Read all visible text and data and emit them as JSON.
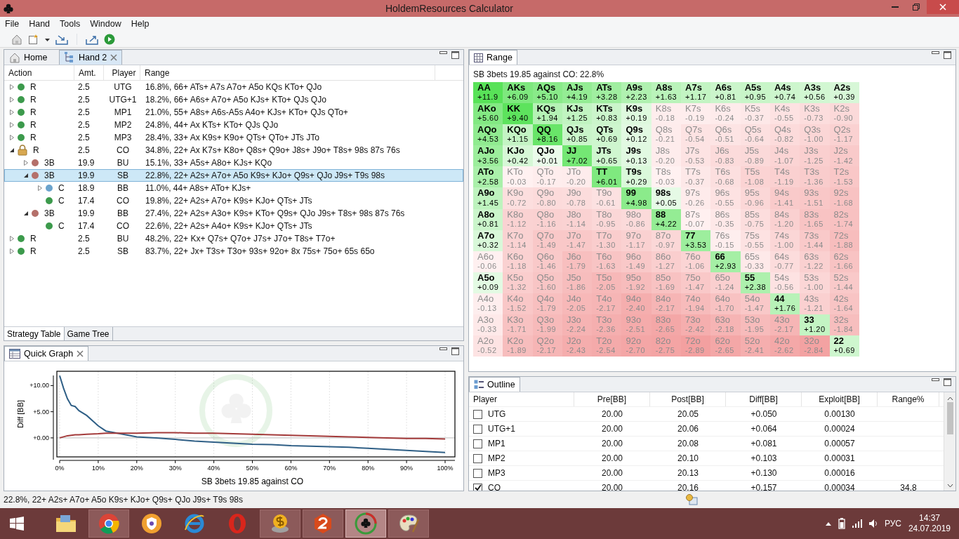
{
  "window": {
    "title": "HoldemResources Calculator"
  },
  "menu": [
    "File",
    "Hand",
    "Tools",
    "Window",
    "Help"
  ],
  "editor": {
    "tabs": [
      {
        "label": "Home",
        "kind": "home",
        "selected": false
      },
      {
        "label": "Hand 2",
        "kind": "hand",
        "selected": true
      }
    ],
    "table": {
      "columns": [
        "Action",
        "Amt.",
        "Player",
        "Range"
      ],
      "rows": [
        {
          "action": "R",
          "amount": "2.5",
          "player": "UTG",
          "range": "16.8%, 66+ ATs+ A7s A7o+ A5o KQs KTo+ QJo",
          "color": "#3c9a4c",
          "locked": false,
          "expanded": false,
          "selected": false
        },
        {
          "action": "R",
          "amount": "2.5",
          "player": "UTG+1",
          "range": "18.2%, 66+ A6s+ A7o+ A5o KJs+ KTo+ QJs QJo",
          "color": "#3c9a4c",
          "locked": false,
          "expanded": false,
          "selected": false
        },
        {
          "action": "R",
          "amount": "2.5",
          "player": "MP1",
          "range": "21.0%, 55+ A8s+ A6s-A5s A4o+ KJs+ KTo+ QJs QTo+",
          "color": "#3c9a4c",
          "locked": false,
          "expanded": false,
          "selected": false
        },
        {
          "action": "R",
          "amount": "2.5",
          "player": "MP2",
          "range": "24.8%, 44+ Ax KTs+ KTo+ QJs QJo",
          "color": "#3c9a4c",
          "locked": false,
          "expanded": false,
          "selected": false
        },
        {
          "action": "R",
          "amount": "2.5",
          "player": "MP3",
          "range": "28.4%, 33+ Ax K9s+ K9o+ QTs+ QTo+ JTs JTo",
          "color": "#3c9a4c",
          "locked": false,
          "expanded": false,
          "selected": false
        },
        {
          "action": "R",
          "amount": "2.5",
          "player": "CO",
          "range": "34.8%, 22+ Ax K7s+ K8o+ Q8s+ Q9o+ J8s+ J9o+ T8s+ 98s 87s 76s",
          "locked": true,
          "expanded": true,
          "selected": false,
          "children": [
            {
              "action": "3B",
              "amount": "19.9",
              "player": "BU",
              "range": "15.1%, 33+ A5s+ A8o+ KJs+ KQo",
              "color": "#b4706a",
              "locked": false,
              "expanded": false,
              "selected": false
            },
            {
              "action": "3B",
              "amount": "19.9",
              "player": "SB",
              "range": "22.8%, 22+ A2s+ A7o+ A5o K9s+ KJo+ Q9s+ QJo J9s+ T9s 98s",
              "color": "#b4706a",
              "locked": false,
              "expanded": true,
              "selected": true,
              "children": [
                {
                  "action": "C",
                  "amount": "18.9",
                  "player": "BB",
                  "range": "11.0%, 44+ A8s+ ATo+ KJs+",
                  "color": "#6ba3cc",
                  "locked": false,
                  "expanded": false,
                  "selected": false
                },
                {
                  "action": "C",
                  "amount": "17.4",
                  "player": "CO",
                  "range": "19.8%, 22+ A2s+ A7o+ K9s+ KJo+ QTs+ JTs",
                  "color": "#3c9a4c",
                  "locked": false,
                  "selected": false
                }
              ]
            },
            {
              "action": "3B",
              "amount": "19.9",
              "player": "BB",
              "range": "27.4%, 22+ A2s+ A3o+ K9s+ KTo+ Q9s+ QJo J9s+ T8s+ 98s 87s 76s",
              "color": "#b4706a",
              "locked": false,
              "expanded": true,
              "selected": false,
              "children": [
                {
                  "action": "C",
                  "amount": "17.4",
                  "player": "CO",
                  "range": "22.6%, 22+ A2s+ A4o+ K9s+ KJo+ QTs+ JTs",
                  "color": "#3c9a4c",
                  "locked": false,
                  "selected": false
                }
              ]
            }
          ]
        },
        {
          "action": "R",
          "amount": "2.5",
          "player": "BU",
          "range": "48.2%, 22+ Kx+ Q7s+ Q7o+ J7s+ J7o+ T8s+ T7o+",
          "color": "#3c9a4c",
          "locked": false,
          "expanded": false,
          "selected": false
        },
        {
          "action": "R",
          "amount": "2.5",
          "player": "SB",
          "range": "83.7%, 22+ Jx+ T3s+ T3o+ 93s+ 92o+ 8x 75s+ 75o+ 65s 65o",
          "color": "#3c9a4c",
          "locked": false,
          "expanded": false,
          "selected": false
        }
      ]
    },
    "bottom_tabs": [
      {
        "label": "Strategy Table",
        "selected": true
      },
      {
        "label": "Game Tree",
        "selected": false
      }
    ]
  },
  "graph": {
    "tab": "Quick Graph",
    "chart_data": {
      "type": "line",
      "xlabel": "SB 3bets 19.85 against CO",
      "ylabel": "Diff [BB]",
      "x": [
        0,
        1,
        2,
        3,
        4,
        5,
        7,
        10,
        12,
        15,
        20,
        25,
        30,
        35,
        40,
        45,
        50,
        55,
        60,
        65,
        70,
        75,
        80,
        85,
        90,
        95,
        100
      ],
      "series": [
        {
          "color": "#2f5f86",
          "values": [
            11.9,
            9.5,
            7.5,
            6.2,
            6.0,
            5.2,
            4.3,
            2.3,
            1.3,
            0.9,
            0.2,
            0.0,
            -0.3,
            -0.6,
            -0.8,
            -1.0,
            -1.2,
            -1.3,
            -1.5,
            -1.6,
            -1.7,
            -1.8,
            -2.0,
            -2.2,
            -2.4,
            -2.6,
            -2.8
          ]
        },
        {
          "color": "#a33a3a",
          "values": [
            0.0,
            0.2,
            0.4,
            0.5,
            0.6,
            0.6,
            0.7,
            0.8,
            0.9,
            0.9,
            0.9,
            1.0,
            1.0,
            0.9,
            0.9,
            0.8,
            0.7,
            0.6,
            0.5,
            0.4,
            0.3,
            0.2,
            0.1,
            0.0,
            -0.1,
            -0.1,
            -0.2
          ]
        }
      ],
      "grid": true,
      "xlim": [
        0,
        100
      ],
      "ylim": [
        -3.5,
        12.6
      ],
      "xticks": [
        {
          "value": 0,
          "label": "0%"
        },
        {
          "value": 10,
          "label": "10%"
        },
        {
          "value": 20,
          "label": "20%"
        },
        {
          "value": 30,
          "label": "30%"
        },
        {
          "value": 40,
          "label": "40%"
        },
        {
          "value": 50,
          "label": "50%"
        },
        {
          "value": 60,
          "label": "60%"
        },
        {
          "value": 70,
          "label": "70%"
        },
        {
          "value": 80,
          "label": "80%"
        },
        {
          "value": 90,
          "label": "90%"
        },
        {
          "value": 100,
          "label": "100%"
        }
      ],
      "yticks": [
        {
          "value": 0,
          "label": "+0.00"
        },
        {
          "value": 5,
          "label": "+5.00"
        },
        {
          "value": 10,
          "label": "+10.00"
        }
      ]
    }
  },
  "range": {
    "tab": "Range",
    "header": "SB 3bets 19.85 against CO: 22.8%",
    "rows": [
      [
        {
          "hand": "AA",
          "ev": "+11.9",
          "in_range": true
        },
        {
          "hand": "AKs",
          "ev": "+6.09",
          "in_range": true
        },
        {
          "hand": "AQs",
          "ev": "+5.10",
          "in_range": true
        },
        {
          "hand": "AJs",
          "ev": "+4.19",
          "in_range": true
        },
        {
          "hand": "ATs",
          "ev": "+3.28",
          "in_range": true
        },
        {
          "hand": "A9s",
          "ev": "+2.23",
          "in_range": true
        },
        {
          "hand": "A8s",
          "ev": "+1.63",
          "in_range": true
        },
        {
          "hand": "A7s",
          "ev": "+1.17",
          "in_range": true
        },
        {
          "hand": "A6s",
          "ev": "+0.81",
          "in_range": true
        },
        {
          "hand": "A5s",
          "ev": "+0.95",
          "in_range": true
        },
        {
          "hand": "A4s",
          "ev": "+0.74",
          "in_range": true
        },
        {
          "hand": "A3s",
          "ev": "+0.56",
          "in_range": true
        },
        {
          "hand": "A2s",
          "ev": "+0.39",
          "in_range": true
        }
      ],
      [
        {
          "hand": "AKo",
          "ev": "+5.60",
          "in_range": true
        },
        {
          "hand": "KK",
          "ev": "+9.40",
          "in_range": true
        },
        {
          "hand": "KQs",
          "ev": "+1.94",
          "in_range": true
        },
        {
          "hand": "KJs",
          "ev": "+1.25",
          "in_range": true
        },
        {
          "hand": "KTs",
          "ev": "+0.83",
          "in_range": true
        },
        {
          "hand": "K9s",
          "ev": "+0.19",
          "in_range": true
        },
        {
          "hand": "K8s",
          "ev": "-0.18",
          "in_range": false
        },
        {
          "hand": "K7s",
          "ev": "-0.19",
          "in_range": false
        },
        {
          "hand": "K6s",
          "ev": "-0.24",
          "in_range": false
        },
        {
          "hand": "K5s",
          "ev": "-0.37",
          "in_range": false
        },
        {
          "hand": "K4s",
          "ev": "-0.55",
          "in_range": false
        },
        {
          "hand": "K3s",
          "ev": "-0.73",
          "in_range": false
        },
        {
          "hand": "K2s",
          "ev": "-0.90",
          "in_range": false
        }
      ],
      [
        {
          "hand": "AQo",
          "ev": "+4.53",
          "in_range": true
        },
        {
          "hand": "KQo",
          "ev": "+1.15",
          "in_range": true
        },
        {
          "hand": "QQ",
          "ev": "+8.16",
          "in_range": true
        },
        {
          "hand": "QJs",
          "ev": "+0.85",
          "in_range": true
        },
        {
          "hand": "QTs",
          "ev": "+0.69",
          "in_range": true
        },
        {
          "hand": "Q9s",
          "ev": "+0.12",
          "in_range": true
        },
        {
          "hand": "Q8s",
          "ev": "-0.21",
          "in_range": false
        },
        {
          "hand": "Q7s",
          "ev": "-0.54",
          "in_range": false
        },
        {
          "hand": "Q6s",
          "ev": "-0.51",
          "in_range": false
        },
        {
          "hand": "Q5s",
          "ev": "-0.64",
          "in_range": false
        },
        {
          "hand": "Q4s",
          "ev": "-0.82",
          "in_range": false
        },
        {
          "hand": "Q3s",
          "ev": "-1.00",
          "in_range": false
        },
        {
          "hand": "Q2s",
          "ev": "-1.17",
          "in_range": false
        }
      ],
      [
        {
          "hand": "AJo",
          "ev": "+3.56",
          "in_range": true
        },
        {
          "hand": "KJo",
          "ev": "+0.42",
          "in_range": true
        },
        {
          "hand": "QJo",
          "ev": "+0.01",
          "in_range": true
        },
        {
          "hand": "JJ",
          "ev": "+7.02",
          "in_range": true
        },
        {
          "hand": "JTs",
          "ev": "+0.65",
          "in_range": true
        },
        {
          "hand": "J9s",
          "ev": "+0.13",
          "in_range": true
        },
        {
          "hand": "J8s",
          "ev": "-0.20",
          "in_range": false
        },
        {
          "hand": "J7s",
          "ev": "-0.53",
          "in_range": false
        },
        {
          "hand": "J6s",
          "ev": "-0.83",
          "in_range": false
        },
        {
          "hand": "J5s",
          "ev": "-0.89",
          "in_range": false
        },
        {
          "hand": "J4s",
          "ev": "-1.07",
          "in_range": false
        },
        {
          "hand": "J3s",
          "ev": "-1.25",
          "in_range": false
        },
        {
          "hand": "J2s",
          "ev": "-1.42",
          "in_range": false
        }
      ],
      [
        {
          "hand": "ATo",
          "ev": "+2.58",
          "in_range": true
        },
        {
          "hand": "KTo",
          "ev": "-0.03",
          "in_range": false
        },
        {
          "hand": "QTo",
          "ev": "-0.17",
          "in_range": false
        },
        {
          "hand": "JTo",
          "ev": "-0.20",
          "in_range": false
        },
        {
          "hand": "TT",
          "ev": "+6.01",
          "in_range": true
        },
        {
          "hand": "T9s",
          "ev": "+0.29",
          "in_range": true
        },
        {
          "hand": "T8s",
          "ev": "-0.03",
          "in_range": false
        },
        {
          "hand": "T7s",
          "ev": "-0.37",
          "in_range": false
        },
        {
          "hand": "T6s",
          "ev": "-0.68",
          "in_range": false
        },
        {
          "hand": "T5s",
          "ev": "-1.08",
          "in_range": false
        },
        {
          "hand": "T4s",
          "ev": "-1.19",
          "in_range": false
        },
        {
          "hand": "T3s",
          "ev": "-1.36",
          "in_range": false
        },
        {
          "hand": "T2s",
          "ev": "-1.53",
          "in_range": false
        }
      ],
      [
        {
          "hand": "A9o",
          "ev": "+1.45",
          "in_range": true
        },
        {
          "hand": "K9o",
          "ev": "-0.72",
          "in_range": false
        },
        {
          "hand": "Q9o",
          "ev": "-0.80",
          "in_range": false
        },
        {
          "hand": "J9o",
          "ev": "-0.78",
          "in_range": false
        },
        {
          "hand": "T9o",
          "ev": "-0.61",
          "in_range": false
        },
        {
          "hand": "99",
          "ev": "+4.98",
          "in_range": true
        },
        {
          "hand": "98s",
          "ev": "+0.05",
          "in_range": true
        },
        {
          "hand": "97s",
          "ev": "-0.26",
          "in_range": false
        },
        {
          "hand": "96s",
          "ev": "-0.55",
          "in_range": false
        },
        {
          "hand": "95s",
          "ev": "-0.96",
          "in_range": false
        },
        {
          "hand": "94s",
          "ev": "-1.41",
          "in_range": false
        },
        {
          "hand": "93s",
          "ev": "-1.51",
          "in_range": false
        },
        {
          "hand": "92s",
          "ev": "-1.68",
          "in_range": false
        }
      ],
      [
        {
          "hand": "A8o",
          "ev": "+0.81",
          "in_range": true
        },
        {
          "hand": "K8o",
          "ev": "-1.12",
          "in_range": false
        },
        {
          "hand": "Q8o",
          "ev": "-1.16",
          "in_range": false
        },
        {
          "hand": "J8o",
          "ev": "-1.14",
          "in_range": false
        },
        {
          "hand": "T8o",
          "ev": "-0.95",
          "in_range": false
        },
        {
          "hand": "98o",
          "ev": "-0.86",
          "in_range": false
        },
        {
          "hand": "88",
          "ev": "+4.22",
          "in_range": true
        },
        {
          "hand": "87s",
          "ev": "-0.07",
          "in_range": false
        },
        {
          "hand": "86s",
          "ev": "-0.35",
          "in_range": false
        },
        {
          "hand": "85s",
          "ev": "-0.75",
          "in_range": false
        },
        {
          "hand": "84s",
          "ev": "-1.20",
          "in_range": false
        },
        {
          "hand": "83s",
          "ev": "-1.65",
          "in_range": false
        },
        {
          "hand": "82s",
          "ev": "-1.74",
          "in_range": false
        }
      ],
      [
        {
          "hand": "A7o",
          "ev": "+0.32",
          "in_range": true
        },
        {
          "hand": "K7o",
          "ev": "-1.14",
          "in_range": false
        },
        {
          "hand": "Q7o",
          "ev": "-1.49",
          "in_range": false
        },
        {
          "hand": "J7o",
          "ev": "-1.47",
          "in_range": false
        },
        {
          "hand": "T7o",
          "ev": "-1.30",
          "in_range": false
        },
        {
          "hand": "97o",
          "ev": "-1.17",
          "in_range": false
        },
        {
          "hand": "87o",
          "ev": "-0.97",
          "in_range": false
        },
        {
          "hand": "77",
          "ev": "+3.53",
          "in_range": true
        },
        {
          "hand": "76s",
          "ev": "-0.15",
          "in_range": false
        },
        {
          "hand": "75s",
          "ev": "-0.55",
          "in_range": false
        },
        {
          "hand": "74s",
          "ev": "-1.00",
          "in_range": false
        },
        {
          "hand": "73s",
          "ev": "-1.44",
          "in_range": false
        },
        {
          "hand": "72s",
          "ev": "-1.88",
          "in_range": false
        }
      ],
      [
        {
          "hand": "A6o",
          "ev": "-0.06",
          "in_range": false
        },
        {
          "hand": "K6o",
          "ev": "-1.18",
          "in_range": false
        },
        {
          "hand": "Q6o",
          "ev": "-1.46",
          "in_range": false
        },
        {
          "hand": "J6o",
          "ev": "-1.79",
          "in_range": false
        },
        {
          "hand": "T6o",
          "ev": "-1.63",
          "in_range": false
        },
        {
          "hand": "96o",
          "ev": "-1.49",
          "in_range": false
        },
        {
          "hand": "86o",
          "ev": "-1.27",
          "in_range": false
        },
        {
          "hand": "76o",
          "ev": "-1.06",
          "in_range": false
        },
        {
          "hand": "66",
          "ev": "+2.93",
          "in_range": true
        },
        {
          "hand": "65s",
          "ev": "-0.33",
          "in_range": false
        },
        {
          "hand": "64s",
          "ev": "-0.77",
          "in_range": false
        },
        {
          "hand": "63s",
          "ev": "-1.22",
          "in_range": false
        },
        {
          "hand": "62s",
          "ev": "-1.66",
          "in_range": false
        }
      ],
      [
        {
          "hand": "A5o",
          "ev": "+0.09",
          "in_range": true
        },
        {
          "hand": "K5o",
          "ev": "-1.32",
          "in_range": false
        },
        {
          "hand": "Q5o",
          "ev": "-1.60",
          "in_range": false
        },
        {
          "hand": "J5o",
          "ev": "-1.86",
          "in_range": false
        },
        {
          "hand": "T5o",
          "ev": "-2.05",
          "in_range": false
        },
        {
          "hand": "95o",
          "ev": "-1.92",
          "in_range": false
        },
        {
          "hand": "85o",
          "ev": "-1.69",
          "in_range": false
        },
        {
          "hand": "75o",
          "ev": "-1.47",
          "in_range": false
        },
        {
          "hand": "65o",
          "ev": "-1.24",
          "in_range": false
        },
        {
          "hand": "55",
          "ev": "+2.38",
          "in_range": true
        },
        {
          "hand": "54s",
          "ev": "-0.56",
          "in_range": false
        },
        {
          "hand": "53s",
          "ev": "-1.00",
          "in_range": false
        },
        {
          "hand": "52s",
          "ev": "-1.44",
          "in_range": false
        }
      ],
      [
        {
          "hand": "A4o",
          "ev": "-0.13",
          "in_range": false
        },
        {
          "hand": "K4o",
          "ev": "-1.52",
          "in_range": false
        },
        {
          "hand": "Q4o",
          "ev": "-1.79",
          "in_range": false
        },
        {
          "hand": "J4o",
          "ev": "-2.05",
          "in_range": false
        },
        {
          "hand": "T4o",
          "ev": "-2.17",
          "in_range": false
        },
        {
          "hand": "94o",
          "ev": "-2.40",
          "in_range": false
        },
        {
          "hand": "84o",
          "ev": "-2.17",
          "in_range": false
        },
        {
          "hand": "74o",
          "ev": "-1.94",
          "in_range": false
        },
        {
          "hand": "64o",
          "ev": "-1.70",
          "in_range": false
        },
        {
          "hand": "54o",
          "ev": "-1.47",
          "in_range": false
        },
        {
          "hand": "44",
          "ev": "+1.76",
          "in_range": true
        },
        {
          "hand": "43s",
          "ev": "-1.21",
          "in_range": false
        },
        {
          "hand": "42s",
          "ev": "-1.64",
          "in_range": false
        }
      ],
      [
        {
          "hand": "A3o",
          "ev": "-0.33",
          "in_range": false
        },
        {
          "hand": "K3o",
          "ev": "-1.71",
          "in_range": false
        },
        {
          "hand": "Q3o",
          "ev": "-1.99",
          "in_range": false
        },
        {
          "hand": "J3o",
          "ev": "-2.24",
          "in_range": false
        },
        {
          "hand": "T3o",
          "ev": "-2.36",
          "in_range": false
        },
        {
          "hand": "93o",
          "ev": "-2.51",
          "in_range": false
        },
        {
          "hand": "83o",
          "ev": "-2.65",
          "in_range": false
        },
        {
          "hand": "73o",
          "ev": "-2.42",
          "in_range": false
        },
        {
          "hand": "63o",
          "ev": "-2.18",
          "in_range": false
        },
        {
          "hand": "53o",
          "ev": "-1.95",
          "in_range": false
        },
        {
          "hand": "43o",
          "ev": "-2.17",
          "in_range": false
        },
        {
          "hand": "33",
          "ev": "+1.20",
          "in_range": true
        },
        {
          "hand": "32s",
          "ev": "-1.84",
          "in_range": false
        }
      ],
      [
        {
          "hand": "A2o",
          "ev": "-0.52",
          "in_range": false
        },
        {
          "hand": "K2o",
          "ev": "-1.89",
          "in_range": false
        },
        {
          "hand": "Q2o",
          "ev": "-2.17",
          "in_range": false
        },
        {
          "hand": "J2o",
          "ev": "-2.43",
          "in_range": false
        },
        {
          "hand": "T2o",
          "ev": "-2.54",
          "in_range": false
        },
        {
          "hand": "92o",
          "ev": "-2.70",
          "in_range": false
        },
        {
          "hand": "82o",
          "ev": "-2.75",
          "in_range": false
        },
        {
          "hand": "72o",
          "ev": "-2.89",
          "in_range": false
        },
        {
          "hand": "62o",
          "ev": "-2.65",
          "in_range": false
        },
        {
          "hand": "52o",
          "ev": "-2.41",
          "in_range": false
        },
        {
          "hand": "42o",
          "ev": "-2.62",
          "in_range": false
        },
        {
          "hand": "32o",
          "ev": "-2.84",
          "in_range": false
        },
        {
          "hand": "22",
          "ev": "+0.69",
          "in_range": true
        }
      ]
    ]
  },
  "outline": {
    "tab": "Outline",
    "columns": [
      "Player",
      "Pre[BB]",
      "Post[BB]",
      "Diff[BB]",
      "Exploit[BB]",
      "Range%"
    ],
    "rows": [
      {
        "player": "UTG",
        "pre": "20.00",
        "post": "20.05",
        "diff": "+0.050",
        "exploit": "0.00130",
        "checked": false
      },
      {
        "player": "UTG+1",
        "pre": "20.00",
        "post": "20.06",
        "diff": "+0.064",
        "exploit": "0.00024",
        "checked": false
      },
      {
        "player": "MP1",
        "pre": "20.00",
        "post": "20.08",
        "diff": "+0.081",
        "exploit": "0.00057",
        "checked": false
      },
      {
        "player": "MP2",
        "pre": "20.00",
        "post": "20.10",
        "diff": "+0.103",
        "exploit": "0.00031",
        "checked": false
      },
      {
        "player": "MP3",
        "pre": "20.00",
        "post": "20.13",
        "diff": "+0.130",
        "exploit": "0.00016",
        "checked": false
      },
      {
        "player": "CO",
        "pre": "20.00",
        "post": "20.16",
        "diff": "+0.157",
        "exploit": "0.00034",
        "range_pct": "34.8",
        "checked": true
      }
    ]
  },
  "status_bar": "22.8%, 22+ A2s+ A7o+ A5o K9s+ KJo+ Q9s+ QJo J9s+ T9s 98s",
  "taskbar": {
    "apps": [
      {
        "kind": "folder",
        "running": false,
        "selected": false
      },
      {
        "kind": "chrome",
        "running": true,
        "selected": false
      },
      {
        "kind": "shield",
        "running": false,
        "selected": false
      },
      {
        "kind": "ie",
        "running": false,
        "selected": false
      },
      {
        "kind": "opera",
        "running": false,
        "selected": false
      },
      {
        "kind": "coins",
        "running": true,
        "selected": false
      },
      {
        "kind": "hexagon",
        "running": true,
        "selected": false
      },
      {
        "kind": "club",
        "running": true,
        "selected": true
      },
      {
        "kind": "palette",
        "running": true,
        "selected": false
      }
    ],
    "language": "РУС",
    "time": "14:37",
    "date": "24.07.2019"
  }
}
